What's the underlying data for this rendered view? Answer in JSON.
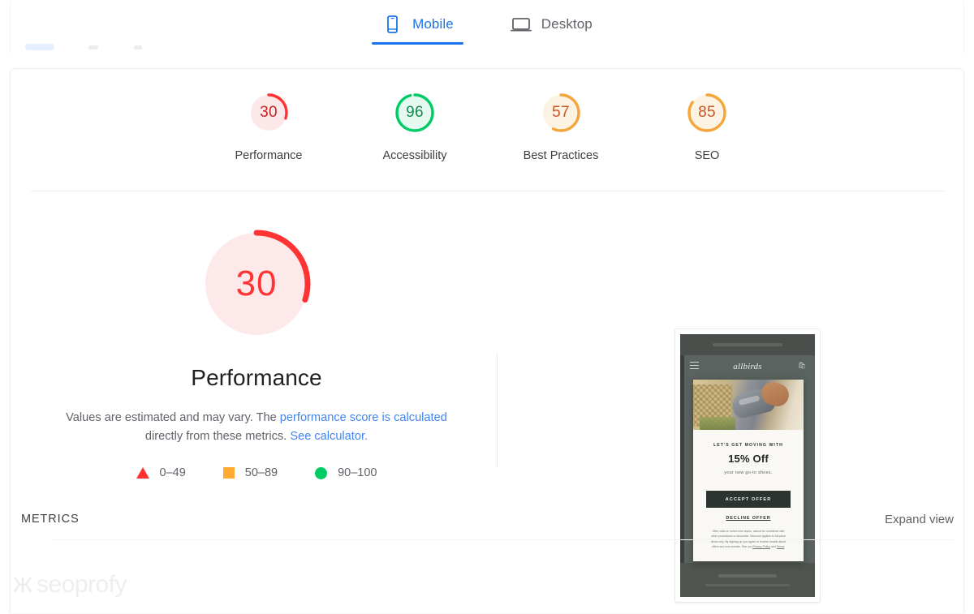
{
  "device_tabs": {
    "items": [
      {
        "label": "Mobile",
        "icon": "mobile-phone-icon",
        "active": true
      },
      {
        "label": "Desktop",
        "icon": "desktop-monitor-icon",
        "active": false
      }
    ]
  },
  "colors": {
    "red": "#f33",
    "red_track": "#fce8e8",
    "orange": "#fa3",
    "orange_track": "#fdf3e3",
    "green": "#0c6",
    "green_track": "#e6f9f0",
    "link_blue": "#4285f4",
    "tab_blue": "#1a73e8"
  },
  "gauges": [
    {
      "value": "30",
      "score": 30,
      "label": "Performance",
      "color": "#f33",
      "track": "#fce8e8"
    },
    {
      "value": "96",
      "score": 96,
      "label": "Accessibility",
      "color": "#0c6",
      "track": "#e6f9f0"
    },
    {
      "value": "57",
      "score": 57,
      "label": "Best Practices",
      "color": "#fa3",
      "track": "#fdf3e3"
    },
    {
      "value": "85",
      "score": 85,
      "label": "SEO",
      "color": "#fa3",
      "track": "#fdf3e3"
    }
  ],
  "performance": {
    "score": "30",
    "score_number": 30,
    "color": "#f33",
    "track": "#fce8e8",
    "title": "Performance",
    "description_part1": "Values are estimated and may vary. The ",
    "description_link1": "performance score is calculated",
    "description_part2": " directly from these metrics. ",
    "description_link2": "See calculator.",
    "legend": [
      {
        "shape": "triangle",
        "label": "0–49",
        "color": "#f33"
      },
      {
        "shape": "square",
        "label": "50–89",
        "color": "#fa3"
      },
      {
        "shape": "circle",
        "label": "90–100",
        "color": "#0c6"
      }
    ]
  },
  "thumbnail": {
    "brand": "allbirds",
    "cart_icon": "shopping-bag-icon",
    "menu_icon": "hamburger-menu-icon",
    "modal": {
      "kicker": "LET'S GET MOVING WITH",
      "headline": "15% Off",
      "subline": "your new go-to shoes.",
      "accept_label": "ACCEPT OFFER",
      "decline_label": "DECLINE OFFER",
      "fine_print_a": "Offer valid on select new styles, cannot be combined with other promotions or discounts. Discount applies to full-price items only.",
      "fine_print_b": "By signing up you agree to receive emails about offers and new arrivals. See our ",
      "fine_print_link1": "Privacy Policy",
      "fine_print_mid": " and ",
      "fine_print_link2": "Terms",
      "fine_print_end": "."
    }
  },
  "footer": {
    "metrics_label": "METRICS",
    "expand_view_label": "Expand view"
  },
  "watermark": {
    "mark": "Ж",
    "text": "seoprofy"
  }
}
